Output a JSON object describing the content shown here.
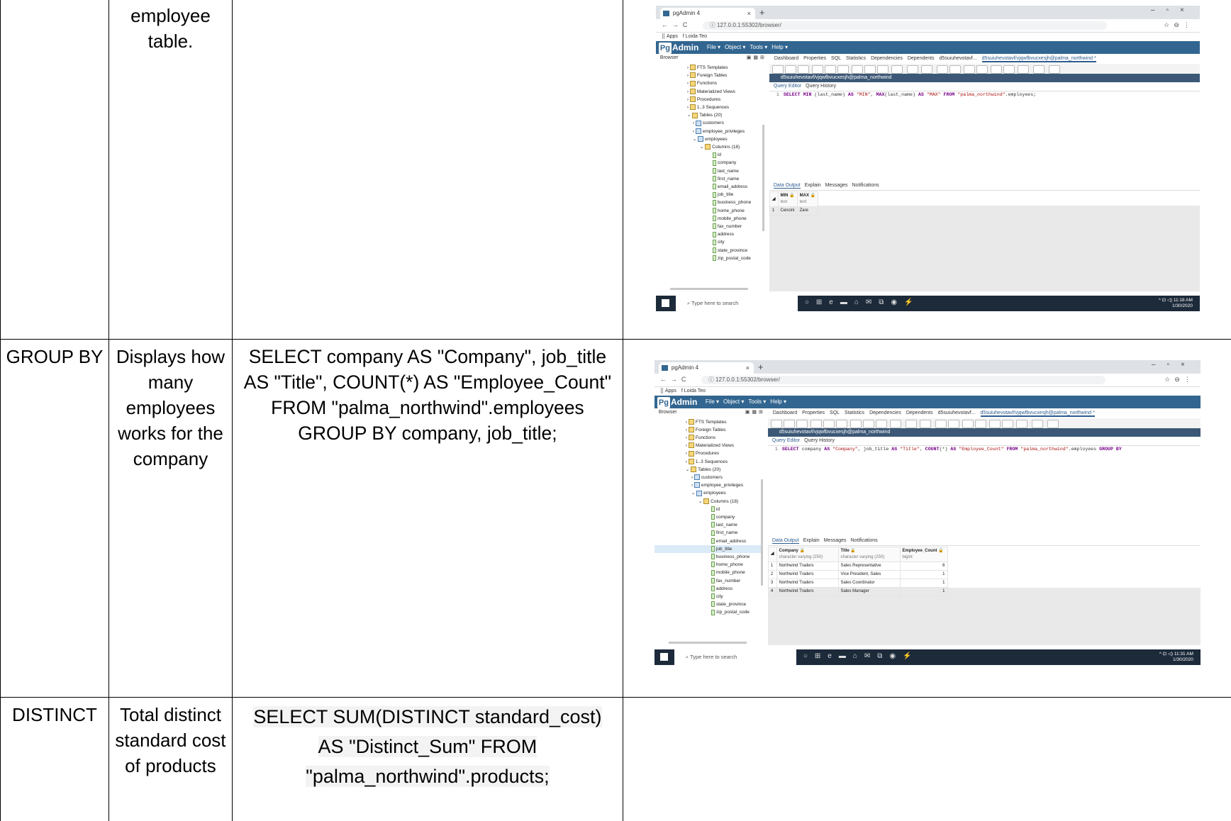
{
  "rows": [
    {
      "keyword": "",
      "description": "employee table.",
      "query": "",
      "screenshot": {
        "tab_title": "pgAdmin 4",
        "url": "127.0.0.1:55302/browser/",
        "bookmarks": [
          "Apps",
          "Loida Teo"
        ],
        "menu": [
          "File ▾",
          "Object ▾",
          "Tools ▾",
          "Help ▾"
        ],
        "browser_title": "Browser",
        "tree": [
          "FTS Templates",
          "Foreign Tables",
          "Functions",
          "Materialized Views",
          "Procedures",
          "1..3 Sequences",
          "Tables (20)",
          "customers",
          "employee_privileges",
          "employees",
          "Columns (18)",
          "id",
          "company",
          "last_name",
          "first_name",
          "email_address",
          "job_title",
          "business_phone",
          "home_phone",
          "mobile_phone",
          "fax_number",
          "address",
          "city",
          "state_province",
          "zip_postal_code"
        ],
        "panel_tabs": [
          "Dashboard",
          "Properties",
          "SQL",
          "Statistics",
          "Dependencies",
          "Dependents",
          "d5suiuhevotavf...",
          "d5suiuhevotavf/vjqwfbvucxesjh@palma_northwind *"
        ],
        "connection": "d5suiuhevotavf/vjqwfbvucxesjh@palma_northwind",
        "editor_tabs": [
          "Query Editor",
          "Query History"
        ],
        "sql": "SELECT MIN (last_name) AS \"MIN\", MAX(last_name) AS \"MAX\" FROM \"palma_northwind\".employees;",
        "output_tabs": [
          "Data Output",
          "Explain",
          "Messages",
          "Notifications"
        ],
        "columns": [
          [
            "MIN",
            "text"
          ],
          [
            "MAX",
            "text"
          ]
        ],
        "data": [
          [
            "1",
            "Cencini",
            "Zare"
          ]
        ],
        "search": "Type here to search",
        "time": "11:18 AM",
        "date": "1/30/2020"
      }
    },
    {
      "keyword": "GROUP BY",
      "description": "Displays how many employees works for the company",
      "query": "SELECT company AS \"Company\", job_title AS \"Title\", COUNT(*) AS \"Employee_Count\" FROM \"palma_northwind\".employees GROUP BY company, job_title;",
      "screenshot": {
        "tab_title": "pgAdmin 4",
        "url": "127.0.0.1:55302/browser/",
        "bookmarks": [
          "Apps",
          "Loida Teo"
        ],
        "menu": [
          "File ▾",
          "Object ▾",
          "Tools ▾",
          "Help ▾"
        ],
        "browser_title": "Browser",
        "tree": [
          "FTS Templates",
          "Foreign Tables",
          "Functions",
          "Materialized Views",
          "Procedures",
          "1..3 Sequences",
          "Tables (20)",
          "customers",
          "employee_privileges",
          "employees",
          "Columns (18)",
          "id",
          "company",
          "last_name",
          "first_name",
          "email_address",
          "job_title",
          "business_phone",
          "home_phone",
          "mobile_phone",
          "fax_number",
          "address",
          "city",
          "state_province",
          "zip_postal_code"
        ],
        "panel_tabs": [
          "Dashboard",
          "Properties",
          "SQL",
          "Statistics",
          "Dependencies",
          "Dependents",
          "d5suiuhevotavf...",
          "d5suiuhevotavf/vjqwfbvucxesjh@palma_northwind *"
        ],
        "connection": "d5suiuhevotavf/vjqwfbvucxesjh@palma_northwind",
        "editor_tabs": [
          "Query Editor",
          "Query History"
        ],
        "sql": "SELECT company AS \"Company\", job_title AS \"Title\", COUNT(*) AS \"Employee_Count\" FROM \"palma_northwind\".employees GROUP BY",
        "output_tabs": [
          "Data Output",
          "Explain",
          "Messages",
          "Notifications"
        ],
        "columns": [
          [
            "Company",
            "character varying (250)"
          ],
          [
            "Title",
            "character varying (250)"
          ],
          [
            "Employee_Count",
            "bigint"
          ]
        ],
        "data": [
          [
            "1",
            "Northwind Traders",
            "Sales Representative",
            "6"
          ],
          [
            "2",
            "Northwind Traders",
            "Vice President, Sales",
            "1"
          ],
          [
            "3",
            "Northwind Traders",
            "Sales Coordinator",
            "1"
          ],
          [
            "4",
            "Northwind Traders",
            "Sales Manager",
            "1"
          ]
        ],
        "search": "Type here to search",
        "time": "11:31 AM",
        "date": "1/30/2020"
      }
    },
    {
      "keyword": "DISTINCT",
      "description": "Total distinct standard cost of products",
      "query": "SELECT SUM(DISTINCT standard_cost) AS \"Distinct_Sum\" FROM \"palma_northwind\".products;"
    }
  ]
}
